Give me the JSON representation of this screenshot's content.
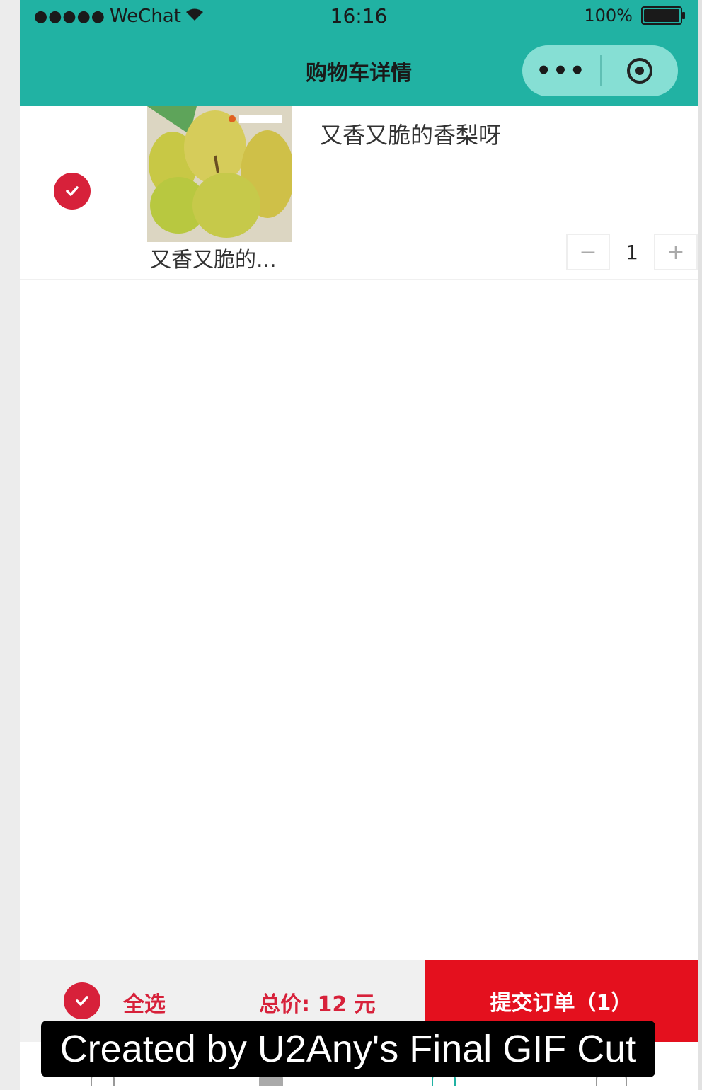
{
  "status_bar": {
    "signal_dots": "●●●●●",
    "carrier": "WeChat",
    "wifi_icon": "wifi-icon",
    "time": "16:16",
    "battery_text": "100%"
  },
  "nav": {
    "title": "购物车详情",
    "more_label": "•••"
  },
  "colors": {
    "header": "#21b2a3",
    "accent_red": "#e4101e",
    "check_red": "#d7213a"
  },
  "cart": {
    "items": [
      {
        "checked": true,
        "image_caption": "又香又脆的...",
        "title": "又香又脆的香梨呀",
        "quantity": "1",
        "minus": "−",
        "plus": "+"
      }
    ]
  },
  "footer": {
    "select_all": "全选",
    "total": "总价: 12 元",
    "submit": "提交订单（1）"
  },
  "watermark": "Created by U2Any's Final GIF Cut"
}
